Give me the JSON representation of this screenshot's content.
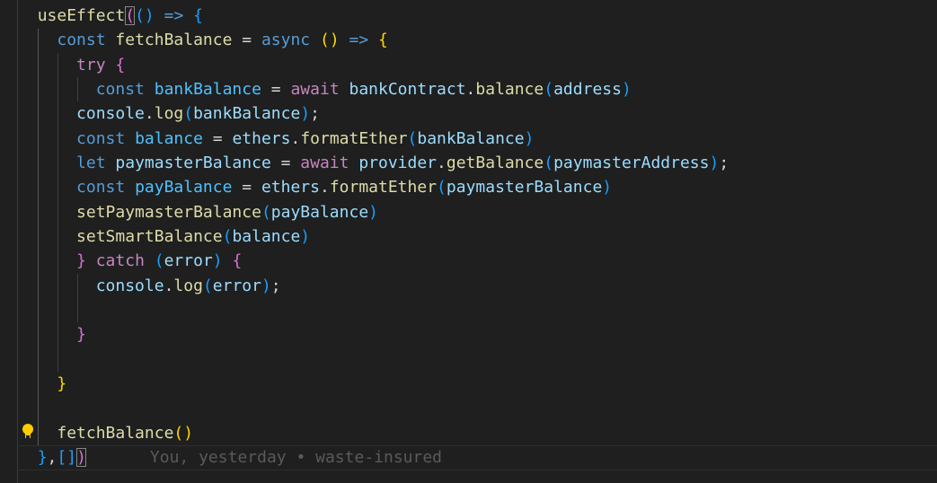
{
  "code_lines": [
    [
      [
        "  ",
        "p"
      ],
      [
        "useEffect",
        "fn"
      ],
      [
        "(",
        "b2 match"
      ],
      [
        "()",
        "b3"
      ],
      [
        " => ",
        "kw"
      ],
      [
        "{",
        "b3"
      ]
    ],
    [
      [
        "    ",
        "p"
      ],
      [
        "const ",
        "kw"
      ],
      [
        "fetchBalance",
        "fn"
      ],
      [
        " = ",
        "p"
      ],
      [
        "async ",
        "kw"
      ],
      [
        "()",
        "b1"
      ],
      [
        " => ",
        "kw"
      ],
      [
        "{",
        "b1"
      ]
    ],
    [
      [
        "      ",
        "p"
      ],
      [
        "try ",
        "ctl"
      ],
      [
        "{",
        "b2"
      ]
    ],
    [
      [
        "        ",
        "p"
      ],
      [
        "const ",
        "kw"
      ],
      [
        "bankBalance",
        "const"
      ],
      [
        " = ",
        "p"
      ],
      [
        "await ",
        "ctl"
      ],
      [
        "bankContract",
        "var"
      ],
      [
        ".",
        "p"
      ],
      [
        "balance",
        "fn"
      ],
      [
        "(",
        "b3"
      ],
      [
        "address",
        "var"
      ],
      [
        ")",
        "b3"
      ]
    ],
    [
      [
        "      ",
        "p"
      ],
      [
        "console",
        "var"
      ],
      [
        ".",
        "p"
      ],
      [
        "log",
        "fn"
      ],
      [
        "(",
        "b3"
      ],
      [
        "bankBalance",
        "var"
      ],
      [
        ")",
        "b3"
      ],
      [
        ";",
        "p"
      ]
    ],
    [
      [
        "      ",
        "p"
      ],
      [
        "const ",
        "kw"
      ],
      [
        "balance",
        "const"
      ],
      [
        " = ",
        "p"
      ],
      [
        "ethers",
        "var"
      ],
      [
        ".",
        "p"
      ],
      [
        "formatEther",
        "fn"
      ],
      [
        "(",
        "b3"
      ],
      [
        "bankBalance",
        "var"
      ],
      [
        ")",
        "b3"
      ]
    ],
    [
      [
        "      ",
        "p"
      ],
      [
        "let ",
        "kw"
      ],
      [
        "paymasterBalance",
        "var"
      ],
      [
        " = ",
        "p"
      ],
      [
        "await ",
        "ctl"
      ],
      [
        "provider",
        "var"
      ],
      [
        ".",
        "p"
      ],
      [
        "getBalance",
        "fn"
      ],
      [
        "(",
        "b3"
      ],
      [
        "paymasterAddress",
        "var"
      ],
      [
        ")",
        "b3"
      ],
      [
        ";",
        "p"
      ]
    ],
    [
      [
        "      ",
        "p"
      ],
      [
        "const ",
        "kw"
      ],
      [
        "payBalance",
        "const"
      ],
      [
        " = ",
        "p"
      ],
      [
        "ethers",
        "var"
      ],
      [
        ".",
        "p"
      ],
      [
        "formatEther",
        "fn"
      ],
      [
        "(",
        "b3"
      ],
      [
        "paymasterBalance",
        "var"
      ],
      [
        ")",
        "b3"
      ]
    ],
    [
      [
        "      ",
        "p"
      ],
      [
        "setPaymasterBalance",
        "fn"
      ],
      [
        "(",
        "b3"
      ],
      [
        "payBalance",
        "var"
      ],
      [
        ")",
        "b3"
      ]
    ],
    [
      [
        "      ",
        "p"
      ],
      [
        "setSmartBalance",
        "fn"
      ],
      [
        "(",
        "b3"
      ],
      [
        "balance",
        "var"
      ],
      [
        ")",
        "b3"
      ]
    ],
    [
      [
        "      ",
        "p"
      ],
      [
        "} ",
        "b2"
      ],
      [
        "catch ",
        "ctl"
      ],
      [
        "(",
        "b3"
      ],
      [
        "error",
        "var"
      ],
      [
        ") ",
        "b3"
      ],
      [
        "{",
        "b2"
      ]
    ],
    [
      [
        "        ",
        "p"
      ],
      [
        "console",
        "var"
      ],
      [
        ".",
        "p"
      ],
      [
        "log",
        "fn"
      ],
      [
        "(",
        "b3"
      ],
      [
        "error",
        "var"
      ],
      [
        ")",
        "b3"
      ],
      [
        ";",
        "p"
      ]
    ],
    [
      [
        "",
        "p"
      ]
    ],
    [
      [
        "      ",
        "p"
      ],
      [
        "}",
        "b2"
      ]
    ],
    [
      [
        "",
        "p"
      ]
    ],
    [
      [
        "    ",
        "p"
      ],
      [
        "}",
        "b1"
      ]
    ],
    [
      [
        "",
        "p"
      ]
    ],
    [
      [
        "    ",
        "p"
      ],
      [
        "fetchBalance",
        "fn"
      ],
      [
        "()",
        "b1"
      ]
    ],
    [
      [
        "  ",
        "p"
      ],
      [
        "}",
        "b3"
      ],
      [
        ",",
        "p"
      ],
      [
        "[]",
        "b3"
      ],
      [
        ")",
        "b2 match"
      ]
    ]
  ],
  "blame": "You, yesterday • waste-insured",
  "colors": {
    "background": "#1f1f1f",
    "keyword": "#569cd6",
    "control": "#c586c0",
    "function": "#dcdcaa",
    "variable": "#9cdcfe"
  }
}
